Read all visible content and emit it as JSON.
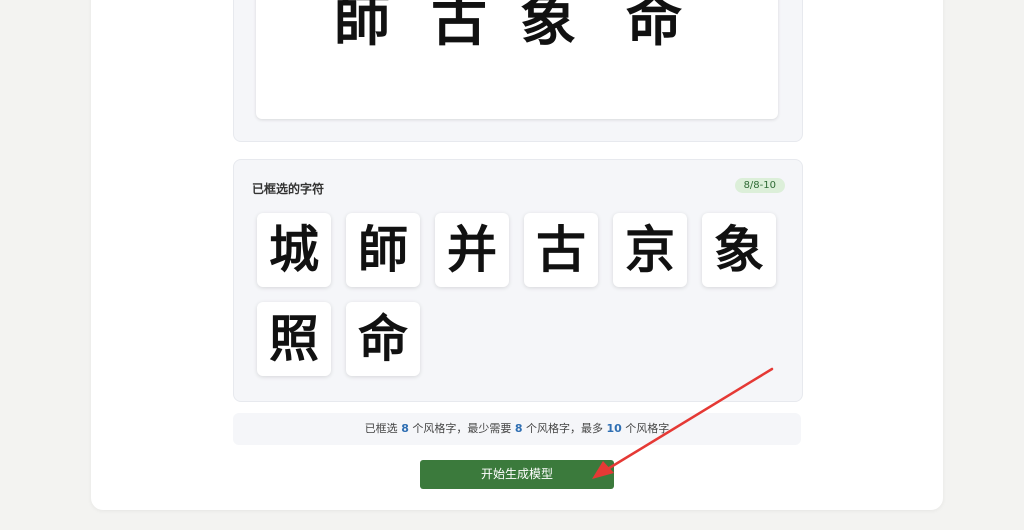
{
  "preview": {
    "glyphs": [
      "師",
      "古",
      "象",
      "命"
    ]
  },
  "selection": {
    "title": "已框选的字符",
    "badge": "8/8-10",
    "characters": [
      "城",
      "師",
      "并",
      "古",
      "京",
      "象",
      "照",
      "命"
    ]
  },
  "info": {
    "part1": "已框选 ",
    "selected_count": "8",
    "part2": " 个风格字，最少需要 ",
    "min_count": "8",
    "part3": " 个风格字，最多 ",
    "max_count": "10",
    "part4": " 个风格字"
  },
  "actions": {
    "generate_label": "开始生成模型"
  },
  "colors": {
    "primary_button": "#3b7a3c",
    "count_highlight": "#2f6fb3",
    "badge_bg": "#dcefd9",
    "annotation_arrow": "#e53935"
  }
}
